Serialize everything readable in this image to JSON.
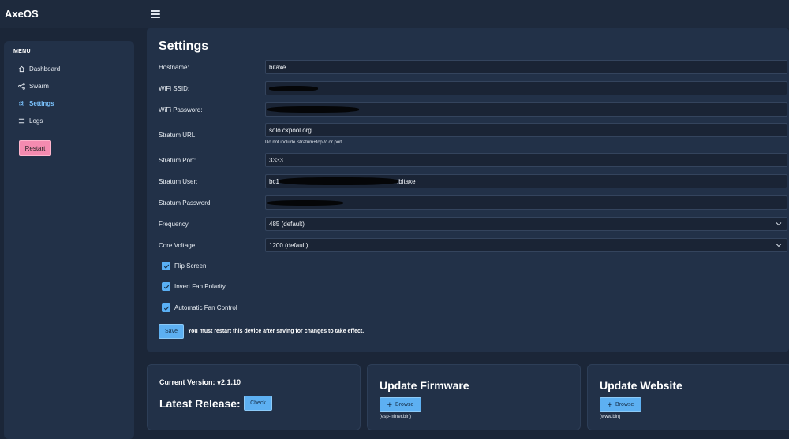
{
  "app": {
    "title": "AxeOS"
  },
  "sidebar": {
    "menu_title": "MENU",
    "items": [
      {
        "label": "Dashboard",
        "icon": "home-icon"
      },
      {
        "label": "Swarm",
        "icon": "share-icon"
      },
      {
        "label": "Settings",
        "icon": "gear-icon",
        "active": true
      },
      {
        "label": "Logs",
        "icon": "list-icon"
      }
    ],
    "restart_label": "Restart"
  },
  "settings": {
    "title": "Settings",
    "fields": [
      {
        "label": "Hostname:",
        "value": "bitaxe"
      },
      {
        "label": "WiFi SSID:",
        "value": ""
      },
      {
        "label": "WiFi Password:",
        "value": ""
      },
      {
        "label": "Stratum URL:",
        "value": "solo.ckpool.org",
        "hint": "Do not include 'stratum+tcp://' or port."
      },
      {
        "label": "Stratum Port:",
        "value": "3333"
      },
      {
        "label": "Stratum User:",
        "value_prefix": "bc1",
        "value_suffix": ".bitaxe"
      },
      {
        "label": "Stratum Password:",
        "value": ""
      },
      {
        "label": "Frequency",
        "value": "485 (default)"
      },
      {
        "label": "Core Voltage",
        "value": "1200 (default)"
      }
    ],
    "checkboxes": [
      {
        "label": "Flip Screen",
        "checked": true
      },
      {
        "label": "Invert Fan Polarity",
        "checked": true
      },
      {
        "label": "Automatic Fan Control",
        "checked": true
      }
    ],
    "save_label": "Save",
    "save_note": "You must restart this device after saving for changes to take effect."
  },
  "version_card": {
    "current_version": "Current Version: v2.1.10",
    "latest_release": "Latest Release:",
    "check_label": "Check"
  },
  "firmware_card": {
    "title": "Update Firmware",
    "browse_label": "Browse",
    "file_hint": "(esp-miner.bin)"
  },
  "website_card": {
    "title": "Update Website",
    "browse_label": "Browse",
    "file_hint": "(www.bin)"
  },
  "colors": {
    "background": "#1b2638",
    "panel": "#223148",
    "accent": "#5db0f2",
    "active_nav": "#7cc4ff",
    "restart": "#f48bb0"
  }
}
